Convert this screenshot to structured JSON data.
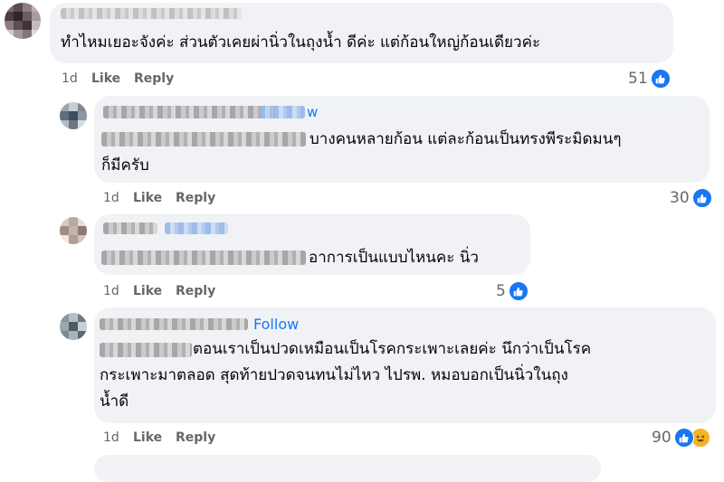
{
  "comments": [
    {
      "text_lines": [
        "ทำไหมเยอะจังค่ะ ส่วนตัวเคยผ่านิ่วในถุงน้ำ ดีค่ะ แต่ก้อนใหญ่ก้อนเดียวค่ะ"
      ],
      "time": "1d",
      "like_label": "Like",
      "reply_label": "Reply",
      "reaction_count": "51"
    },
    {
      "text_lines": [
        "บางคนหลายก้อน แต่ละก้อนเป็นทรงพีระมิดมนๆ",
        "ก็มีครับ"
      ],
      "follow_partial": "w",
      "time": "1d",
      "like_label": "Like",
      "reply_label": "Reply",
      "reaction_count": "30"
    },
    {
      "text_lines": [
        "อาการเป็นแบบไหนคะ นิ่ว"
      ],
      "time": "1d",
      "like_label": "Like",
      "reply_label": "Reply",
      "reaction_count": "5"
    },
    {
      "follow_label": "Follow",
      "text_lines": [
        "ตอนเราเป็นปวดเหมือนเป็นโรคกระเพาะเลยค่ะ นึกว่าเป็นโรค",
        "กระเพาะมาตลอด สุดท้ายปวดจนทนไม่ไหว ไปรพ. หมอบอกเป็นนิ่วในถุง",
        "น้ำดี"
      ],
      "time": "1d",
      "like_label": "Like",
      "reply_label": "Reply",
      "reaction_count": "90"
    }
  ],
  "colors": {
    "bubble": "#f0f2f5",
    "link": "#1877f2",
    "meta": "#65676b",
    "like": "#1877f2",
    "haha": "#f7b125"
  },
  "icons": [
    "like-reaction-icon",
    "haha-reaction-icon"
  ]
}
